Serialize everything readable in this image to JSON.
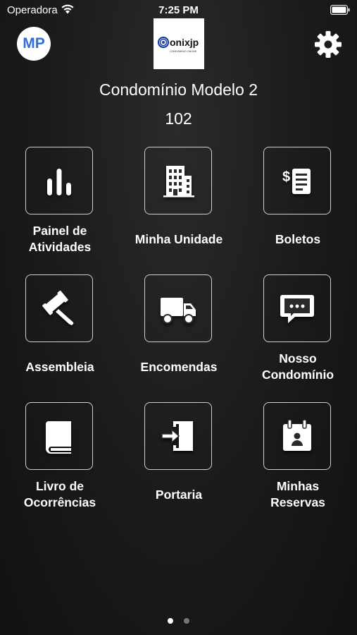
{
  "status_bar": {
    "carrier": "Operadora",
    "time": "7:25 PM"
  },
  "header": {
    "avatar_initials": "MP",
    "logo_text": "onixjp",
    "logo_subtext": "CONDOMINIO ONLINE"
  },
  "condo": {
    "name": "Condomínio Modelo 2",
    "unit": "102"
  },
  "tiles": [
    {
      "line1": "Painel de",
      "line2": "Atividades",
      "icon": "bar-chart-icon"
    },
    {
      "line1": "Minha Unidade",
      "line2": "",
      "icon": "building-icon"
    },
    {
      "line1": "Boletos",
      "line2": "",
      "icon": "invoice-icon"
    },
    {
      "line1": "Assembleia",
      "line2": "",
      "icon": "gavel-icon"
    },
    {
      "line1": "Encomendas",
      "line2": "",
      "icon": "truck-icon"
    },
    {
      "line1": "Nosso",
      "line2": "Condomínio",
      "icon": "chat-bubble-icon"
    },
    {
      "line1": "Livro de",
      "line2": "Ocorrências",
      "icon": "book-icon"
    },
    {
      "line1": "Portaria",
      "line2": "",
      "icon": "door-enter-icon"
    },
    {
      "line1": "Minhas",
      "line2": "Reservas",
      "icon": "calendar-person-icon"
    }
  ],
  "pagination": {
    "current": 1,
    "total": 2
  },
  "colors": {
    "avatar_text": "#2f6fd6",
    "tile_border": "#cfcfcf",
    "background": "#1a1a1a"
  }
}
